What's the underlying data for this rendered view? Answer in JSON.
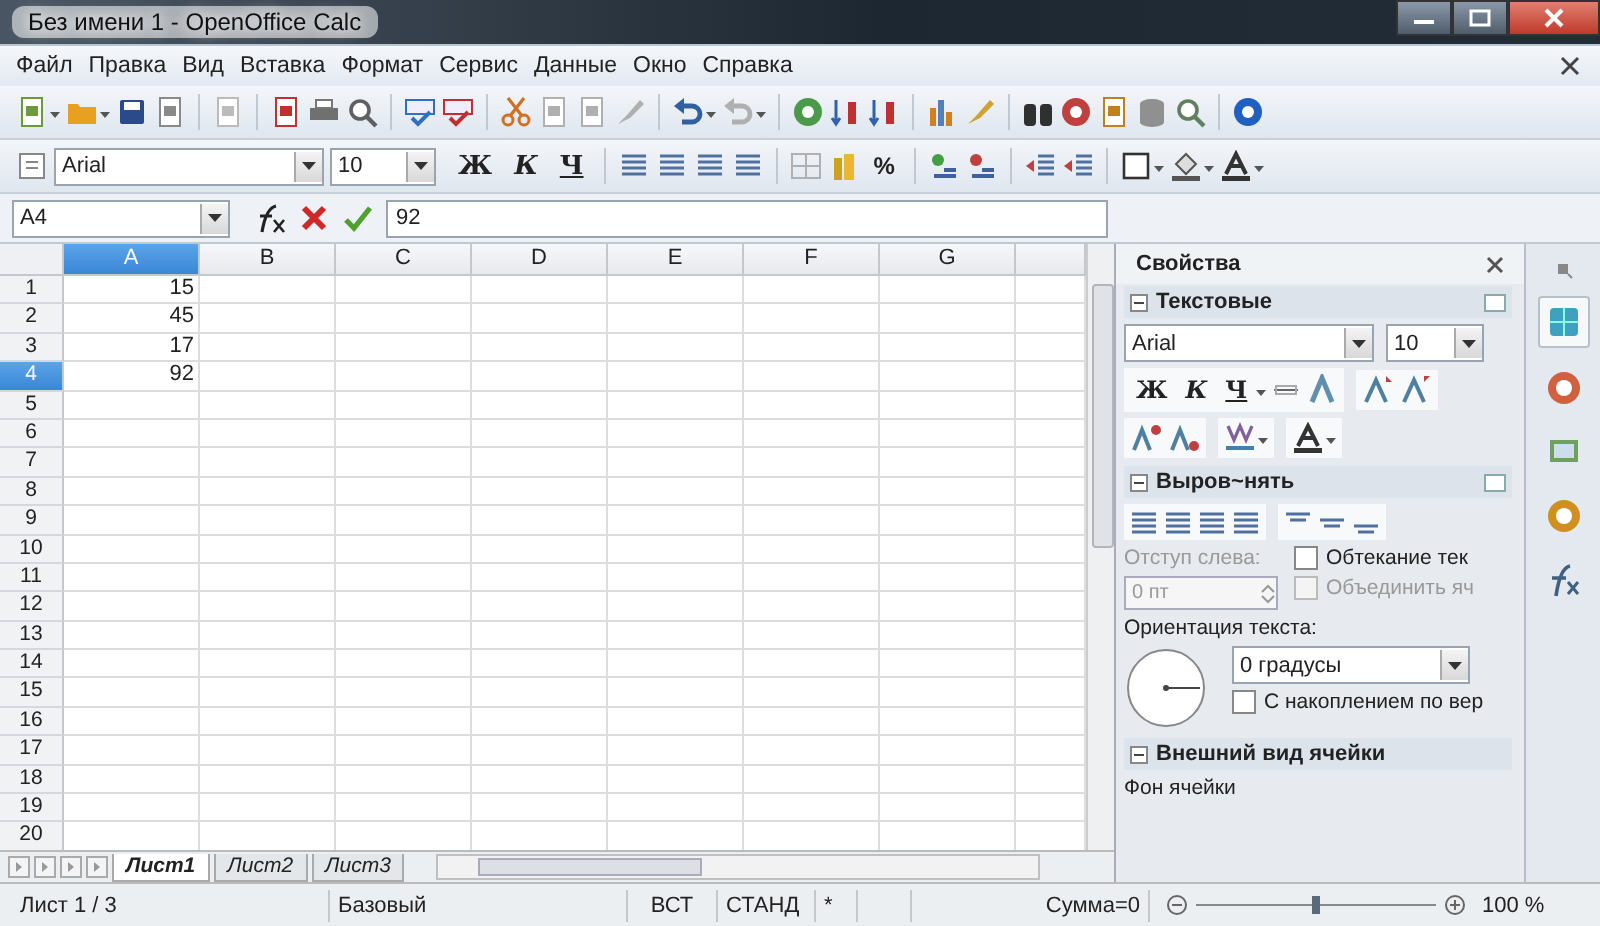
{
  "window": {
    "title": "Без имени 1 - OpenOffice Calc"
  },
  "menu": [
    "Файл",
    "Правка",
    "Вид",
    "Вставка",
    "Формат",
    "Сервис",
    "Данные",
    "Окно",
    "Справка"
  ],
  "format_toolbar": {
    "font": "Arial",
    "size": "10",
    "bold": "Ж",
    "italic": "К",
    "underline": "Ч",
    "percent": "%"
  },
  "formula_bar": {
    "cell_ref": "A4",
    "value": "92"
  },
  "sheet": {
    "columns": [
      {
        "label": "A",
        "selected": true
      },
      {
        "label": "B",
        "selected": false
      },
      {
        "label": "C",
        "selected": false
      },
      {
        "label": "D",
        "selected": false
      },
      {
        "label": "E",
        "selected": false
      },
      {
        "label": "F",
        "selected": false
      },
      {
        "label": "G",
        "selected": false
      }
    ],
    "rows": [
      {
        "label": "1",
        "selected": false,
        "value": "15"
      },
      {
        "label": "2",
        "selected": false,
        "value": "45"
      },
      {
        "label": "3",
        "selected": false,
        "value": "17"
      },
      {
        "label": "4",
        "selected": true,
        "value": "92"
      },
      {
        "label": "5",
        "selected": false
      },
      {
        "label": "6",
        "selected": false
      },
      {
        "label": "7",
        "selected": false
      },
      {
        "label": "8",
        "selected": false
      },
      {
        "label": "9",
        "selected": false
      },
      {
        "label": "10",
        "selected": false
      },
      {
        "label": "11",
        "selected": false
      },
      {
        "label": "12",
        "selected": false
      },
      {
        "label": "13",
        "selected": false
      },
      {
        "label": "14",
        "selected": false
      },
      {
        "label": "15",
        "selected": false
      },
      {
        "label": "16",
        "selected": false
      },
      {
        "label": "17",
        "selected": false
      },
      {
        "label": "18",
        "selected": false
      },
      {
        "label": "19",
        "selected": false
      },
      {
        "label": "20",
        "selected": false
      }
    ],
    "tabs": [
      {
        "label": "Лист1",
        "selected": true
      },
      {
        "label": "Лист2",
        "selected": false
      },
      {
        "label": "Лист3",
        "selected": false
      }
    ]
  },
  "sidebar": {
    "title": "Свойства",
    "text_section": {
      "title": "Текстовые",
      "expanded": true,
      "font": "Arial",
      "size": "10",
      "bold": "Ж",
      "italic": "К",
      "underline": "Ч"
    },
    "align_section": {
      "title": "Выров~нять",
      "expanded": true,
      "indent_label": "Отступ слева:",
      "indent_value": "0 пт",
      "indent_disabled": true,
      "checkboxes": [
        {
          "label": "Обтекание тек",
          "checked": false,
          "disabled": false
        },
        {
          "label": "Объединить яч",
          "checked": false,
          "disabled": true
        }
      ],
      "orientation_label": "Ориентация текста:",
      "orientation_value": "0 градусы",
      "stack": {
        "label": "С накоплением по вер",
        "checked": false,
        "disabled": false
      }
    },
    "cell_section": {
      "title": "Внешний вид ячейки",
      "expanded": true,
      "first_item": "Фон ячейки"
    }
  },
  "status_bar": {
    "sheet": "Лист 1 / 3",
    "style": "Базовый",
    "insert_mode": "ВСТ",
    "selection_mode": "СТАНД",
    "modified": "*",
    "sum": "Сумма=0",
    "zoom": "100 %",
    "zoom_slider": {
      "level": 0.5
    }
  }
}
